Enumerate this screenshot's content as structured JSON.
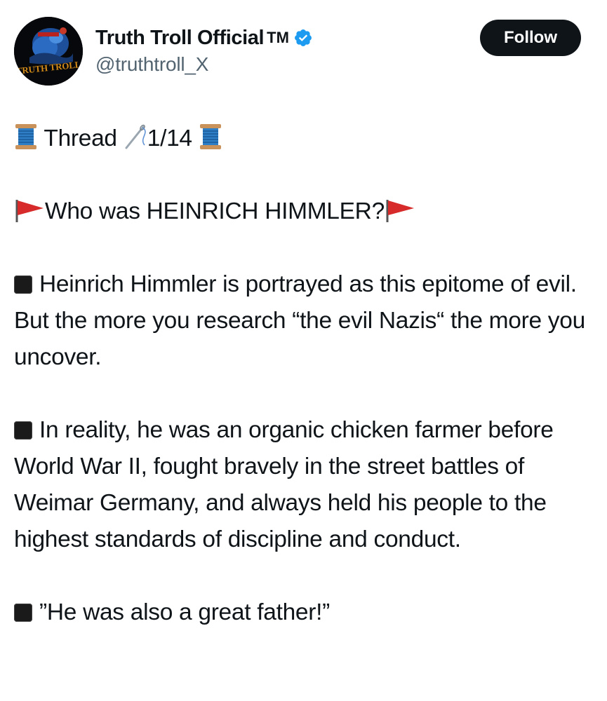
{
  "profile": {
    "display_name": "Truth Troll Official",
    "trademark": "TM",
    "handle": "@truthtroll_X",
    "avatar_text": "TRUTH TROLL",
    "verified": true,
    "verified_color": "#1d9bf0"
  },
  "actions": {
    "follow_label": "Follow"
  },
  "tweet": {
    "thread_label": "Thread",
    "thread_count": "1/14",
    "heading": "Who was HEINRICH HIMMLER?",
    "paragraph_1": "Heinrich Himmler is portrayed as this epitome of evil. But the more you research “the evil Nazis“ the more you uncover.",
    "paragraph_2": "In reality, he was an organic chicken farmer before World War II, fought bravely in the street battles of Weimar Germany, and always held his people to the highest standards of discipline and conduct.",
    "paragraph_3": "”He was also a great father!”"
  },
  "icons": {
    "thread_spool": "spool-of-thread-icon",
    "needle": "sewing-needle-icon",
    "flag": "red-triangular-flag-icon",
    "bullet": "black-square-icon"
  },
  "colors": {
    "text": "#0f1419",
    "secondary_text": "#536471",
    "button_bg": "#0f1419",
    "flag_red": "#d72a2a",
    "spool_blue": "#2f7fc6"
  }
}
